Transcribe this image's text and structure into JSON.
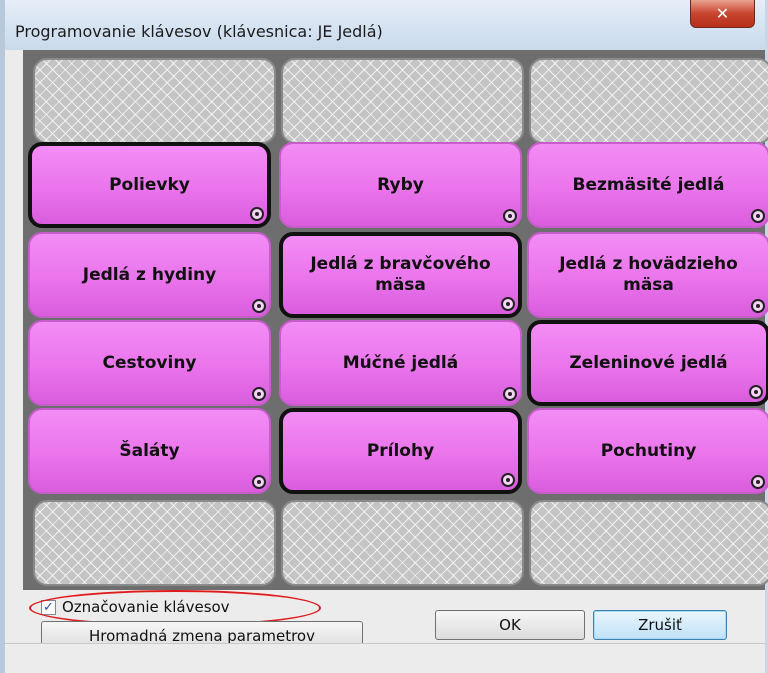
{
  "window": {
    "title": "Programovanie klávesov (klávesnica: JE  Jedlá)",
    "close_glyph": "✕"
  },
  "keys": [
    {
      "label": "Polievky",
      "selected": true
    },
    {
      "label": "Ryby",
      "selected": false
    },
    {
      "label": "Bezmäsité jedlá",
      "selected": false
    },
    {
      "label": "Jedlá z hydiny",
      "selected": false
    },
    {
      "label": "Jedlá z bravčového mäsa",
      "selected": true
    },
    {
      "label": "Jedlá z hovädzieho mäsa",
      "selected": false
    },
    {
      "label": "Cestoviny",
      "selected": false
    },
    {
      "label": "Múčné jedlá",
      "selected": false
    },
    {
      "label": "Zeleninové jedlá",
      "selected": true
    },
    {
      "label": "Šaláty",
      "selected": false
    },
    {
      "label": "Prílohy",
      "selected": true
    },
    {
      "label": "Pochutiny",
      "selected": false
    }
  ],
  "footer": {
    "checkbox_label": "Označovanie klávesov",
    "checkbox_checked": true,
    "bulk_button": "Hromadná zmena parametrov",
    "ok_button": "OK",
    "cancel_button": "Zrušiť"
  },
  "colors": {
    "key_fill": "#ea74ec",
    "selected_border": "#111111",
    "highlight_ellipse": "#e01b1b"
  }
}
